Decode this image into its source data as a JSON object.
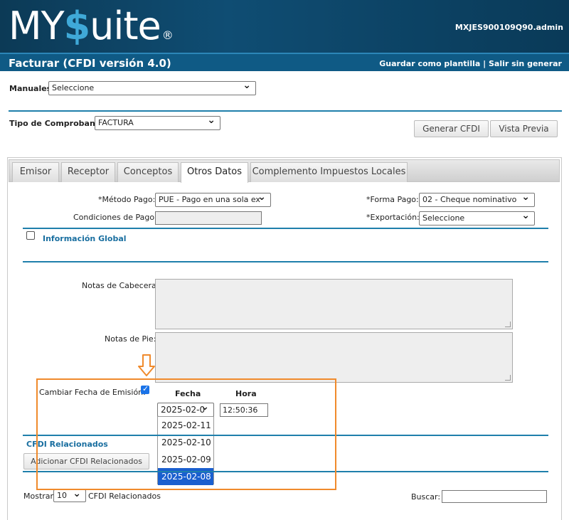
{
  "header": {
    "logo_my": "MY",
    "logo_dollar": "$",
    "logo_uite": "uite",
    "logo_reg": "®",
    "user": "MXJES900109Q90.admin"
  },
  "titlebar": {
    "title": "Facturar (CFDI versión 4.0)",
    "save_template": "Guardar como plantilla",
    "separator": " | ",
    "exit": "Salir sin generar"
  },
  "manuales": {
    "label": "Manuales:",
    "value": "Seleccione"
  },
  "tipo": {
    "label": "Tipo de Comprobante:",
    "value": "FACTURA"
  },
  "actions": {
    "generar": "Generar CFDI",
    "vista": "Vista Previa"
  },
  "tabs": [
    {
      "label": "Emisor"
    },
    {
      "label": "Receptor"
    },
    {
      "label": "Conceptos"
    },
    {
      "label": "Otros Datos",
      "active": true
    },
    {
      "label": "Complemento Impuestos Locales"
    }
  ],
  "form": {
    "metodo_label": "*Método Pago:",
    "metodo_value": "PUE - Pago en una sola ex",
    "forma_label": "*Forma Pago:",
    "forma_value": "02 - Cheque nominativo",
    "condiciones_label": "Condiciones de Pago:",
    "condiciones_value": "",
    "exportacion_label": "*Exportación:",
    "exportacion_value": "Seleccione",
    "info_global": "Información Global",
    "notas_cabecera_label": "Notas de Cabecera:",
    "notas_pie_label": "Notas de Pie:",
    "cambiar_fecha_label": "Cambiar Fecha de Emisión:",
    "fecha_header": "Fecha",
    "hora_header": "Hora",
    "fecha_value": "2025-02-0",
    "hora_value": "12:50:36",
    "fecha_options": [
      "2025-02-11",
      "2025-02-10",
      "2025-02-09",
      "2025-02-08"
    ],
    "fecha_selected_index": 3
  },
  "cfdi": {
    "title": "CFDI Relacionados",
    "add_button": "Adicionar CFDI Relacionados",
    "mostrar": "Mostrar",
    "mostrar_value": "10",
    "mostrar_suffix": "CFDI Relacionados",
    "buscar": "Buscar:"
  },
  "colors": {
    "header": "#0f4d73",
    "titlebar": "#0f5a85",
    "rule": "#1f7fab",
    "highlight": "#f08a2c",
    "selected_option": "#1a5fcf"
  }
}
